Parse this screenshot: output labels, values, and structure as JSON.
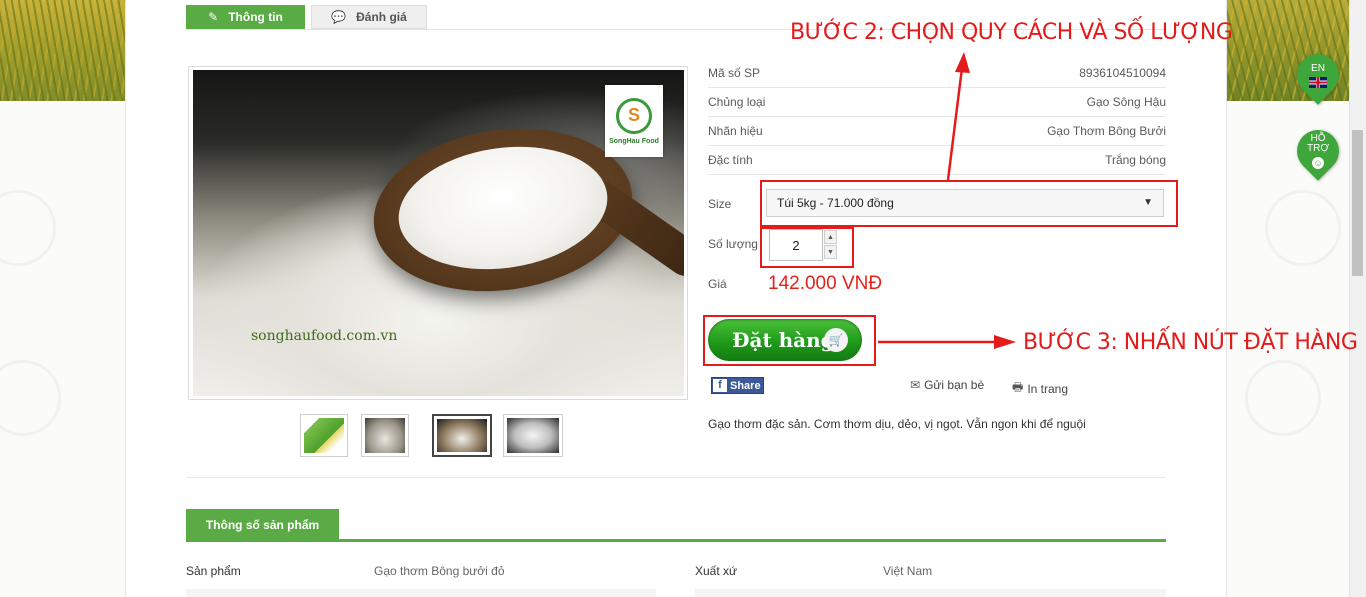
{
  "tabs": {
    "info_label": "Thông tin",
    "review_label": "Đánh giá"
  },
  "product_image": {
    "logo_text": "SongHau Food",
    "site_text": "songhaufood.com.vn"
  },
  "specs": [
    {
      "label": "Mã số SP",
      "value": "8936104510094"
    },
    {
      "label": "Chủng loại",
      "value": "Gạo Sông Hậu"
    },
    {
      "label": "Nhãn hiệu",
      "value": "Gạo Thơm Bông Bưởi"
    },
    {
      "label": "Đặc tính",
      "value": "Trắng bóng"
    }
  ],
  "order": {
    "size_label": "Size",
    "size_value": "Túi 5kg - 71.000 đồng",
    "qty_label": "Số lượng",
    "qty_value": "2",
    "price_label": "Giá",
    "price_value": "142.000 VNĐ",
    "order_button": "Đặt hàng"
  },
  "share": {
    "facebook": "Share",
    "send_friend": "Gửi bạn bè",
    "print": "In trang"
  },
  "description": "Gạo thơm đặc sản. Cơm thơm dịu, dẻo, vị ngọt. Vẫn ngon khi để nguội",
  "spec_section": {
    "title": "Thông số sản phẩm",
    "rows": [
      {
        "k1": "Sản phẩm",
        "v1": "Gạo thơm Bông bưởi đỏ",
        "k2": "Xuất xứ",
        "v2": "Việt Nam"
      }
    ]
  },
  "side": {
    "lang": "EN",
    "support_line1": "HỖ",
    "support_line2": "TRỢ"
  },
  "annotations": {
    "step2": "BƯỚC 2: CHỌN QUY CÁCH VÀ SỐ LƯỢNG",
    "step3": "BƯỚC 3: NHẤN NÚT ĐẶT HÀNG"
  },
  "icons": {
    "info_tab": "edit-icon",
    "review_tab": "comment-icon",
    "cart": "cart-icon",
    "mail": "mail-icon",
    "print": "print-icon",
    "dropdown": "chevron-down-icon"
  },
  "colors": {
    "brand_green": "#5aab45",
    "price_red": "#e2231a",
    "annotation_red": "#e31b1b"
  }
}
